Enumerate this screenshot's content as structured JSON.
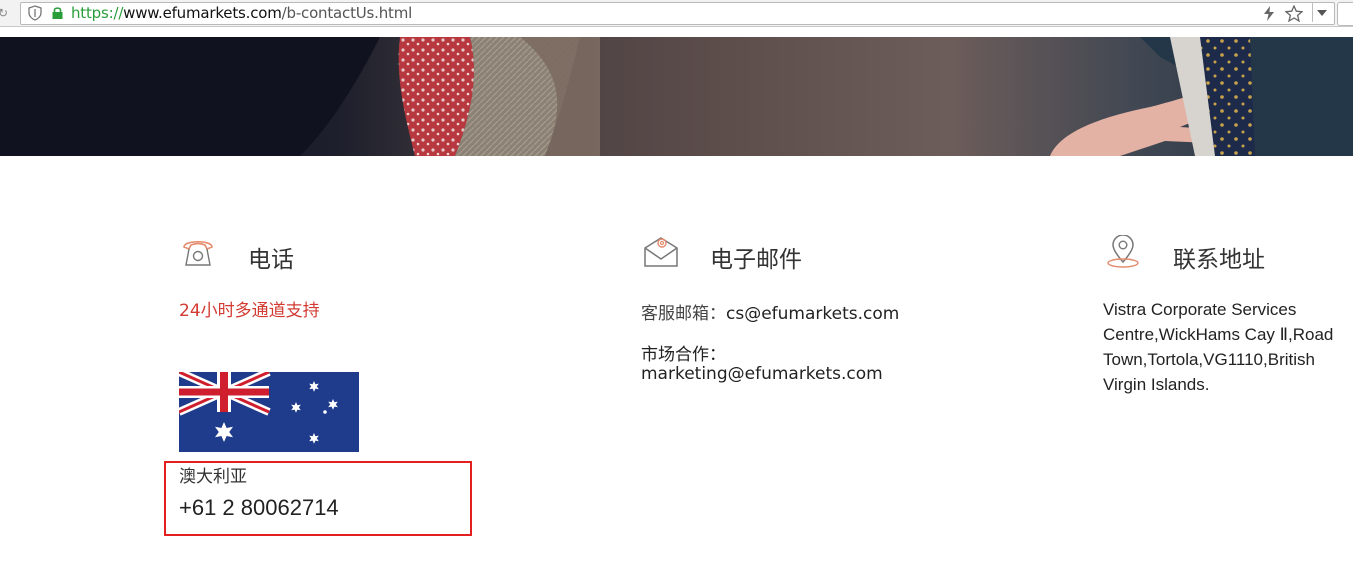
{
  "browser": {
    "url_scheme": "https://",
    "url_host": "www.efumarkets.com",
    "url_path": "/b-contactUs.html"
  },
  "phone_section": {
    "title": "电话",
    "support_text": "24小时多通道支持",
    "country": "澳大利亚",
    "number": "+61 2 80062714",
    "accent_color": "#d23a32"
  },
  "email_section": {
    "title": "电子邮件",
    "service_label": "客服邮箱：",
    "service_email": "cs@efumarkets.com",
    "marketing_label": "市场合作：",
    "marketing_email": "marketing@efumarkets.com"
  },
  "address_section": {
    "title": "联系地址",
    "address": "Vistra Corporate Services\nCentre,WickHams Cay Ⅱ,Road\nTown,Tortola,VG1110,British\nVirgin Islands."
  },
  "icons": {
    "phone": "telephone-icon",
    "email": "envelope-at-icon",
    "address": "location-pin-icon"
  }
}
